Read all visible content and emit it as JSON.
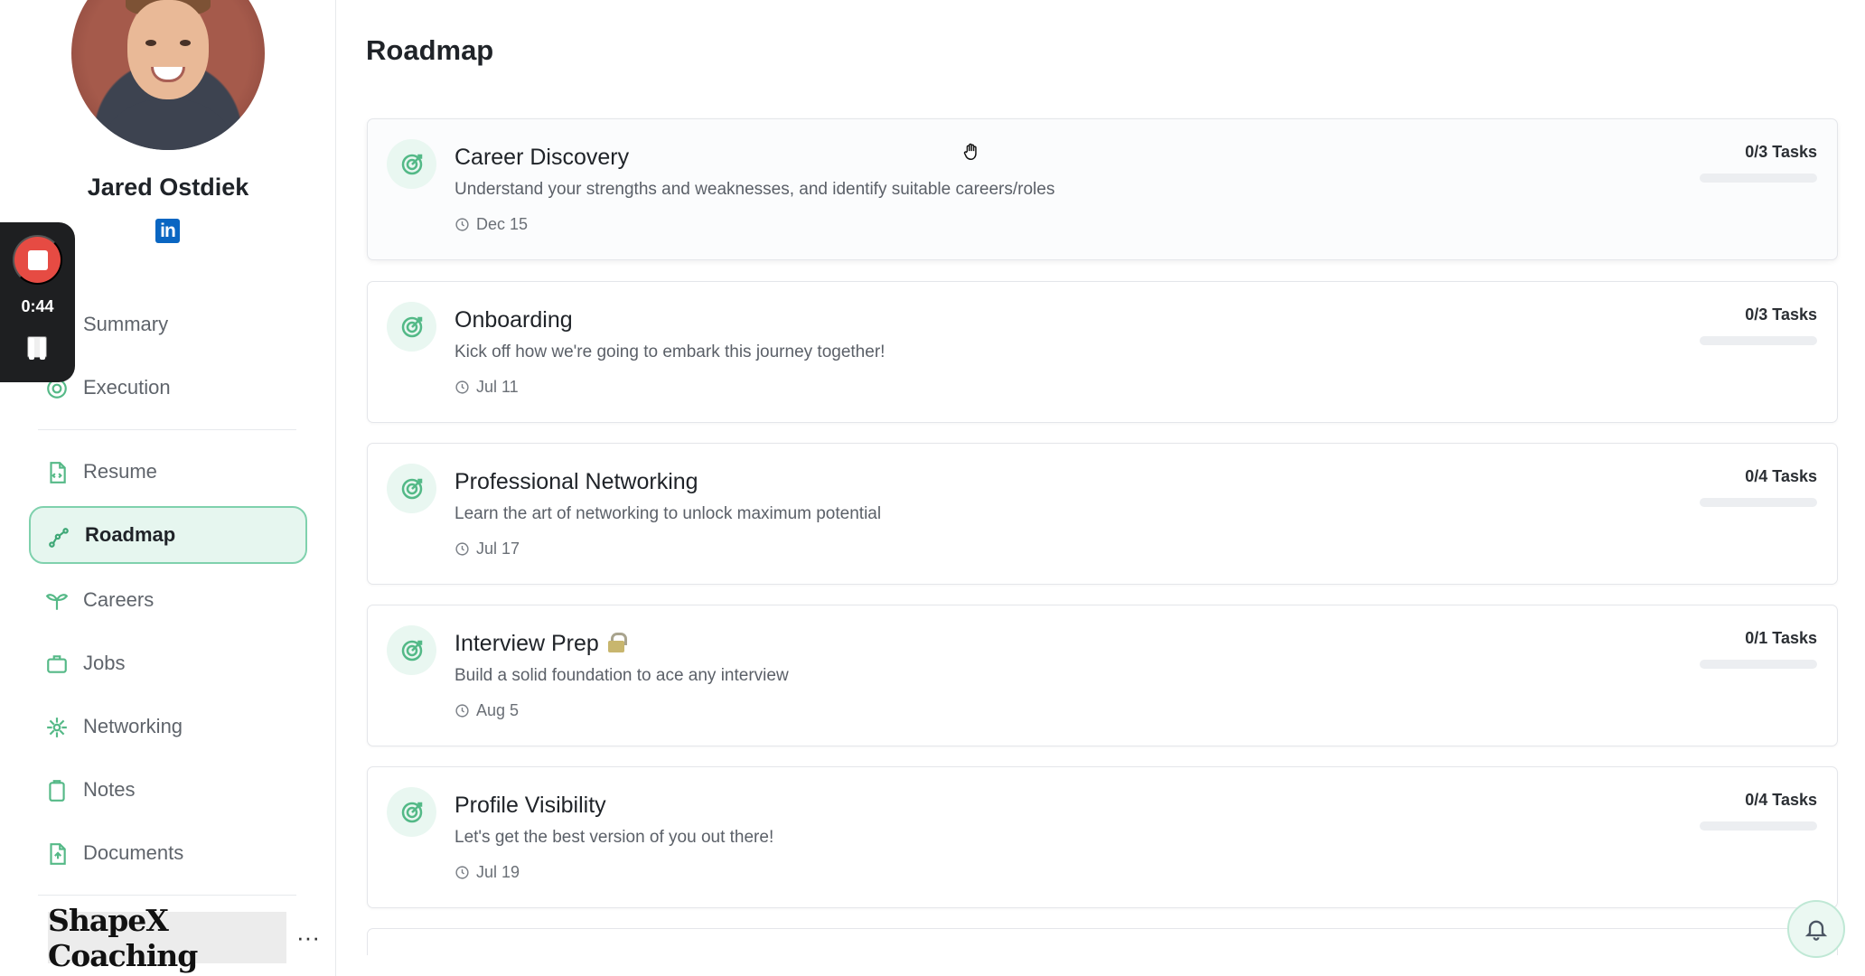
{
  "profile": {
    "name": "Jared Ostdiek",
    "linkedin_label": "in"
  },
  "recorder": {
    "time": "0:44"
  },
  "sidebar": {
    "items": [
      {
        "label": "Summary",
        "icon": "chart-icon"
      },
      {
        "label": "Execution",
        "icon": "target-icon"
      },
      {
        "label": "Resume",
        "icon": "resume-icon"
      },
      {
        "label": "Roadmap",
        "icon": "roadmap-icon",
        "active": true
      },
      {
        "label": "Careers",
        "icon": "sprout-icon"
      },
      {
        "label": "Jobs",
        "icon": "briefcase-icon"
      },
      {
        "label": "Networking",
        "icon": "network-icon"
      },
      {
        "label": "Notes",
        "icon": "clipboard-icon"
      },
      {
        "label": "Documents",
        "icon": "document-icon"
      }
    ],
    "brand": "ShapeX Coaching",
    "more": "···"
  },
  "main": {
    "title": "Roadmap",
    "cards": [
      {
        "title": "Career Discovery",
        "description": "Understand your strengths and weaknesses, and identify suitable careers/roles",
        "date": "Dec 15",
        "tasks": "0/3 Tasks",
        "progress": 0,
        "locked": false
      },
      {
        "title": "Onboarding",
        "description": "Kick off how we're going to embark this journey together!",
        "date": "Jul 11",
        "tasks": "0/3 Tasks",
        "progress": 0,
        "locked": false
      },
      {
        "title": "Professional Networking",
        "description": "Learn the art of networking to unlock maximum potential",
        "date": "Jul 17",
        "tasks": "0/4 Tasks",
        "progress": 0,
        "locked": false
      },
      {
        "title": "Interview Prep",
        "description": "Build a solid foundation to ace any interview",
        "date": "Aug 5",
        "tasks": "0/1 Tasks",
        "progress": 0,
        "locked": true
      },
      {
        "title": "Profile Visibility",
        "description": "Let's get the best version of you out there!",
        "date": "Jul 19",
        "tasks": "0/4 Tasks",
        "progress": 0,
        "locked": false
      }
    ]
  },
  "colors": {
    "accent": "#54C08C",
    "accent_light": "#E6F6EF",
    "recorder_red": "#E64B43",
    "linkedin": "#0A66C2"
  }
}
